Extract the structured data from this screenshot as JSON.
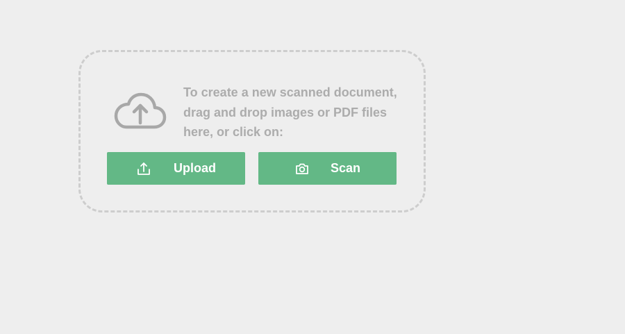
{
  "dropzone": {
    "icon": "cloud-upload-icon",
    "instructions": "To create a new scanned document, drag and drop images or PDF files here, or click on:"
  },
  "buttons": {
    "upload": {
      "label": "Upload",
      "icon": "upload-tray-icon"
    },
    "scan": {
      "label": "Scan",
      "icon": "camera-icon"
    }
  },
  "colors": {
    "background": "#eeeeee",
    "dashed_border": "#cdcdcd",
    "text_muted": "#acacac",
    "icon_muted": "#a8a8a8",
    "button_green": "#63b886",
    "button_text": "#ffffff"
  }
}
